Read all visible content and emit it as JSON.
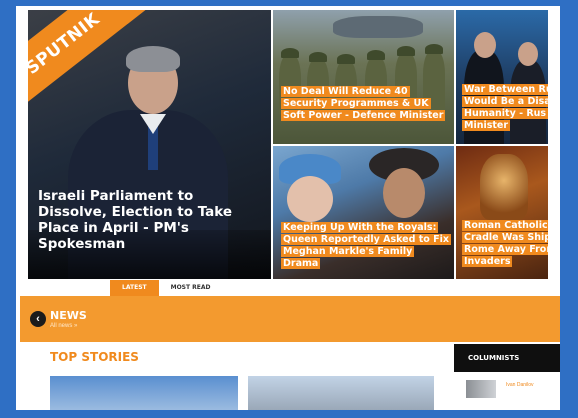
{
  "brand": {
    "logo": "SPUTNIK",
    "accent": "#f08a1e",
    "frame_color": "#2f6fc4"
  },
  "hero": {
    "main_story": "Israeli Parliament to Dissolve, Election to Take Place in April - PM's Spokesman",
    "stories": [
      "No Deal Will Reduce 40 Security Programmes & UK Soft Power - Defence Minister",
      "War Between Ru Would Be a Disa Humanity - Rus Minister",
      "Keeping Up With the Royals: Queen Reportedly Asked to Fix Meghan Markle's Family Drama",
      "Roman Catholics Cradle Was Shipp Rome Away Fron Invaders"
    ]
  },
  "tabs": {
    "latest": "LATEST",
    "most_read": "MOST READ"
  },
  "news": {
    "title": "NEWS",
    "subtitle": "All news »"
  },
  "sections": {
    "top_stories": "TOP STORIES",
    "columnists": "COLUMNISTS",
    "columnist_name": "Ivan Danilov"
  }
}
